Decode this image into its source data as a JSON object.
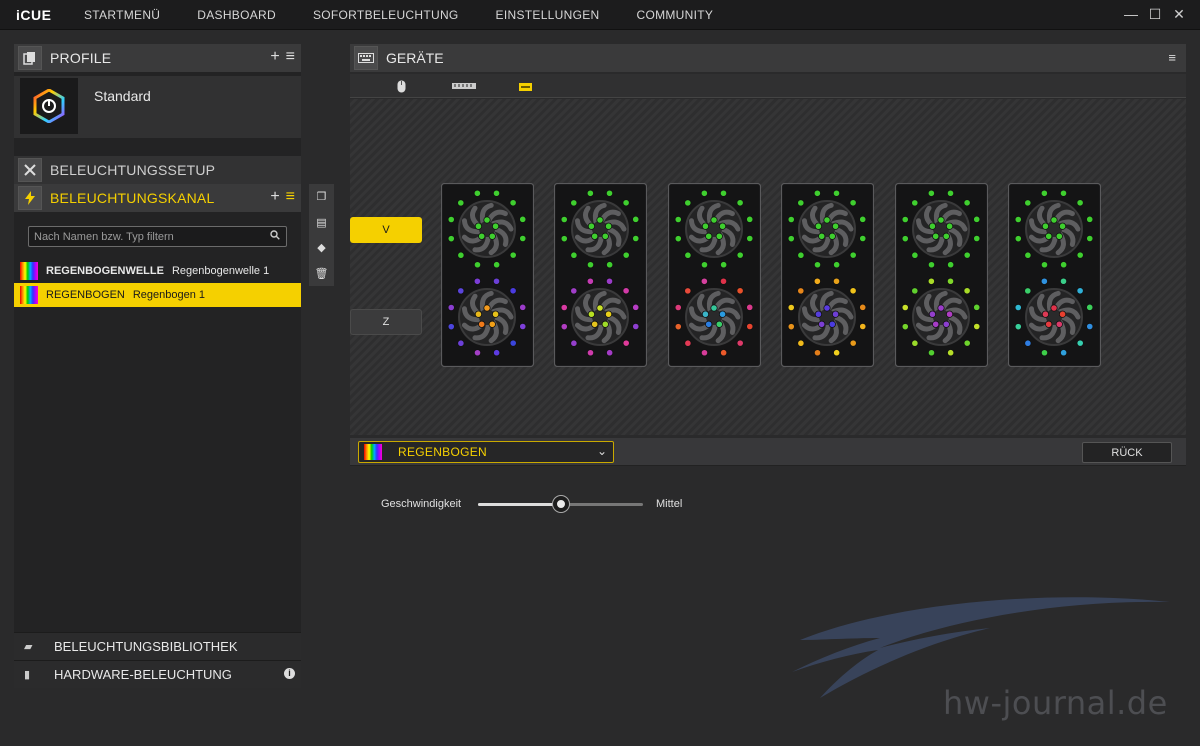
{
  "app": {
    "logo": "iCUE"
  },
  "nav": [
    "STARTMENÜ",
    "DASHBOARD",
    "SOFORTBELEUCHTUNG",
    "EINSTELLUNGEN",
    "COMMUNITY"
  ],
  "window": {
    "minimize": "—",
    "maximize": "☐",
    "close": "✕"
  },
  "profile": {
    "header": "PROFILE",
    "add": "+",
    "menu": "≡",
    "name": "Standard"
  },
  "setup": {
    "header": "BELEUCHTUNGSSETUP"
  },
  "channel": {
    "header": "BELEUCHTUNGSKANAL",
    "add": "+",
    "menu": "≡",
    "search_placeholder": "Nach Namen bzw. Typ filtern",
    "layers": [
      {
        "name": "REGENBOGENWELLE",
        "sub": "Regenbogenwelle 1"
      },
      {
        "name": "REGENBOGEN",
        "sub": "Regenbogen 1"
      }
    ]
  },
  "library": {
    "header": "BELEUCHTUNGSBIBLIOTHEK"
  },
  "hardware": {
    "header": "HARDWARE-BELEUCHTUNG",
    "info": "i"
  },
  "devices": {
    "header": "GERÄTE",
    "menu": "≡"
  },
  "zones": {
    "v": "V",
    "z": "Z"
  },
  "fan_count": 6,
  "top_fan_color": "#3fcf2f",
  "bottom_fans": [
    {
      "center": [
        "#f39a1d",
        "#e8c21a",
        "#f2a018",
        "#f07a1a",
        "#e9b81b"
      ],
      "outer": [
        "#6b3fd6",
        "#4a3be0",
        "#9b3cc9",
        "#7d3fd9",
        "#3a45dc",
        "#5c3be2",
        "#a33fc5",
        "#6c40d8",
        "#4c45de",
        "#8a3ed0",
        "#5a44dc",
        "#7b3dd6"
      ]
    },
    {
      "center": [
        "#c9e02a",
        "#e9d01a",
        "#9fdc2a",
        "#e5c41e",
        "#b8e023"
      ],
      "outer": [
        "#9b3cc9",
        "#d23aa8",
        "#b63dc4",
        "#8e3fd0",
        "#e03a9a",
        "#a43cc6",
        "#cf3bac",
        "#953fcc",
        "#b13dc2",
        "#da3aa2",
        "#a03ec8",
        "#c53cb4"
      ]
    },
    {
      "center": [
        "#35c79a",
        "#2a9be0",
        "#3acf6a",
        "#2b7ee2",
        "#3bb5c8"
      ],
      "outer": [
        "#e0324a",
        "#e8502a",
        "#d93a8c",
        "#e8442f",
        "#de3a6a",
        "#ec5a2a",
        "#d73c9a",
        "#e33a55",
        "#e6622a",
        "#dc3a7a",
        "#e84a3a",
        "#d5409e"
      ]
    },
    {
      "center": [
        "#5a3be0",
        "#6e3fd6",
        "#4a3be0",
        "#7c3fd4",
        "#553ddc"
      ],
      "outer": [
        "#e8a21a",
        "#f0c21a",
        "#e68a1a",
        "#f2b41c",
        "#e99a1a",
        "#f0d01e",
        "#e47e1a",
        "#f1ba1b",
        "#e8921a",
        "#eec81d",
        "#e7861a",
        "#f2ac1b"
      ]
    },
    {
      "center": [
        "#9b3cc9",
        "#b03dc4",
        "#8c3fd0",
        "#a63cc6",
        "#933fcc"
      ],
      "outer": [
        "#7fd72a",
        "#a9dc28",
        "#5ed02e",
        "#c3e02a",
        "#6ed42c",
        "#b6de29",
        "#52cf30",
        "#9bdb2a",
        "#74d52b",
        "#c9e12a",
        "#60d02e",
        "#aadc28"
      ]
    },
    {
      "center": [
        "#e0324a",
        "#e8402f",
        "#d93a6a",
        "#e53a3f",
        "#dc3a55"
      ],
      "outer": [
        "#3acf8a",
        "#2fb0d8",
        "#3ccf5a",
        "#2f8ee0",
        "#36cfb0",
        "#2fa0dc",
        "#3ecf4a",
        "#2f7de2",
        "#38cf9a",
        "#2fb8d2",
        "#3acf6a",
        "#2f92e0"
      ]
    }
  ],
  "effect": {
    "selected": "REGENBOGEN",
    "back": "RÜCK"
  },
  "speed": {
    "label": "Geschwindigkeit",
    "value_label": "Mittel",
    "position": 0.5
  },
  "watermark": "hw-journal.de",
  "accent_color": "#f5d000"
}
